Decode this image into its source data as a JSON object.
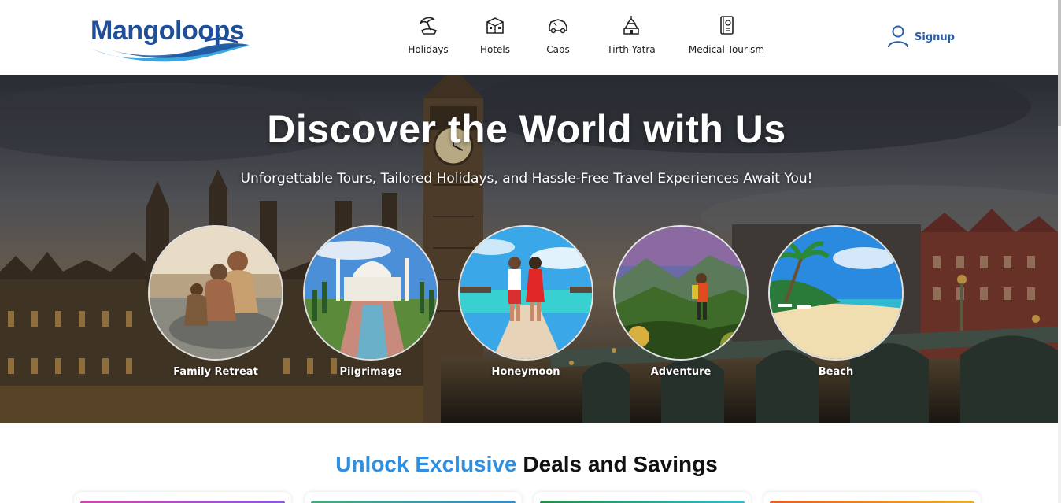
{
  "brand": {
    "name": "Mangoloops",
    "color": "#1f4f99"
  },
  "nav": {
    "items": [
      {
        "label": "Holidays",
        "icon": "umbrella-icon"
      },
      {
        "label": "Hotels",
        "icon": "hotel-icon"
      },
      {
        "label": "Cabs",
        "icon": "car-icon"
      },
      {
        "label": "Tirth Yatra",
        "icon": "temple-icon"
      },
      {
        "label": "Medical Tourism",
        "icon": "medical-passport-icon"
      }
    ]
  },
  "account": {
    "signup_label": "Signup",
    "icon": "user-icon"
  },
  "hero": {
    "title": "Discover the World with Us",
    "subtitle": "Unforgettable Tours, Tailored Holidays, and Hassle-Free Travel Experiences Await You!",
    "categories": [
      {
        "label": "Family Retreat"
      },
      {
        "label": "Pilgrimage"
      },
      {
        "label": "Honeymoon"
      },
      {
        "label": "Adventure"
      },
      {
        "label": "Beach"
      }
    ]
  },
  "deals": {
    "heading_accent": "Unlock Exclusive",
    "heading_rest": " Deals and Savings"
  },
  "colors": {
    "accent": "#2f8fe0",
    "signup": "#2a5fa8"
  }
}
